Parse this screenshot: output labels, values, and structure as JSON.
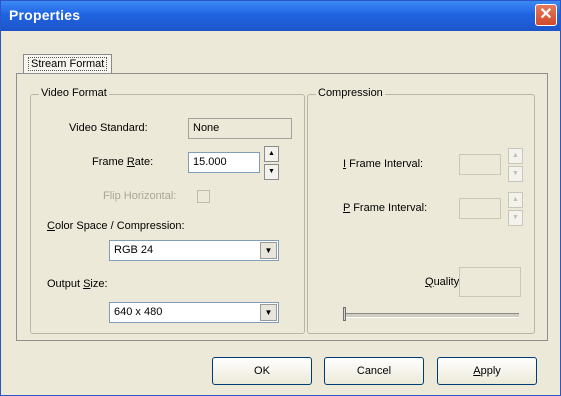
{
  "window": {
    "title": "Properties",
    "close_glyph": "✕"
  },
  "tabs": [
    {
      "label": "Stream Format"
    }
  ],
  "video_format": {
    "title": "Video Format",
    "video_standard": {
      "label": "Video Standard:",
      "value": "None"
    },
    "frame_rate": {
      "label_pre": "Frame ",
      "label_key": "R",
      "label_post": "ate:",
      "value": "15.000"
    },
    "flip_horizontal": {
      "label": "Flip Horizontal:"
    },
    "color_space": {
      "label_key": "C",
      "label_post": "olor Space / Compression:",
      "value": "RGB 24"
    },
    "output_size": {
      "label_pre": "Output ",
      "label_key": "S",
      "label_post": "ize:",
      "value": "640 x 480"
    }
  },
  "compression": {
    "title": "Compression",
    "i_frame": {
      "label_key": "I",
      "label_post": " Frame Interval:",
      "value": ""
    },
    "p_frame": {
      "label_key": "P",
      "label_post": " Frame Interval:",
      "value": ""
    },
    "quality": {
      "label_key": "Q",
      "label_post": "uality:",
      "value": "",
      "level": 0
    }
  },
  "buttons": {
    "ok": "OK",
    "cancel": "Cancel",
    "apply_key": "A",
    "apply_post": "pply"
  },
  "icons": {
    "spin_up": "▲",
    "spin_down": "▼",
    "dropdown": "▼"
  }
}
